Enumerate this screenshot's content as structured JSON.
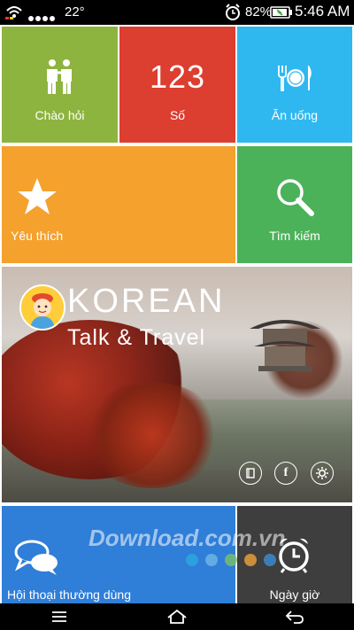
{
  "status_bar": {
    "temperature": "22°",
    "battery": "82%",
    "time": "5:46 AM"
  },
  "tiles": [
    {
      "id": "greetings",
      "label": "Chào hỏi",
      "color": "#8db43f",
      "icon": "greeting-people-icon"
    },
    {
      "id": "numbers",
      "label": "Số",
      "color": "#dc3e30",
      "icon": "numbers-icon",
      "icon_text": "123"
    },
    {
      "id": "eating",
      "label": "Ăn uống",
      "color": "#2fb8f0",
      "icon": "fork-plate-knife-icon"
    },
    {
      "id": "favorites",
      "label": "Yêu thích",
      "color": "#f4a12e",
      "icon": "star-icon"
    },
    {
      "id": "search",
      "label": "Tìm kiếm",
      "color": "#4cb25a",
      "icon": "search-icon"
    },
    {
      "id": "conversation",
      "label": "Hội thoại thường dùng",
      "color": "#2f7ed8",
      "icon": "chat-bubbles-icon"
    },
    {
      "id": "datetime",
      "label": "Ngày giờ",
      "color": "#3e3e3e",
      "icon": "alarm-clock-icon"
    }
  ],
  "banner": {
    "title": "KOREAN",
    "subtitle": "Talk & Travel"
  },
  "watermark": {
    "text": "Download.com.vn",
    "dot_colors": [
      "#2aa9e0",
      "#6fb6e8",
      "#7cc16a",
      "#f0a23a",
      "#3b8fd3"
    ]
  }
}
